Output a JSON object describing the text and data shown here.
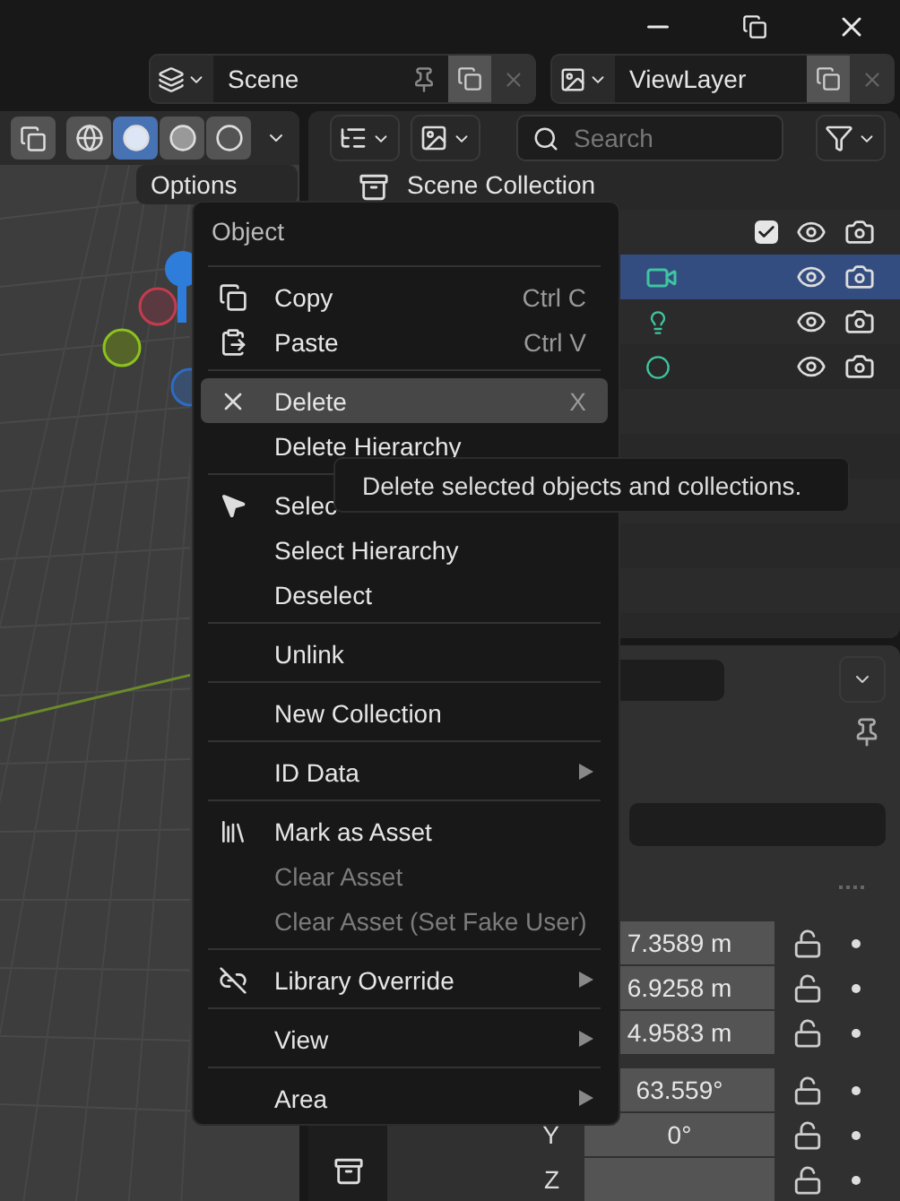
{
  "scene_selector": {
    "name": "Scene"
  },
  "view_layer_selector": {
    "name": "ViewLayer"
  },
  "viewport": {
    "shading_modes": [
      {
        "kind": "wireframe",
        "selected": false
      },
      {
        "kind": "solid",
        "selected": true
      },
      {
        "kind": "material",
        "selected": false
      },
      {
        "kind": "rendered",
        "selected": false
      }
    ],
    "options_label": "Options"
  },
  "outliner": {
    "search": {
      "placeholder": "Search"
    },
    "root": "Scene Collection",
    "rows": [
      {
        "kind": "collection",
        "selected": false,
        "checked": true
      },
      {
        "kind": "camera",
        "selected": true
      },
      {
        "kind": "light",
        "selected": false
      },
      {
        "kind": "mesh",
        "selected": false
      }
    ]
  },
  "properties": {
    "location": [
      "7.3589 m",
      "6.9258 m",
      "4.9583 m"
    ],
    "rotation": [
      {
        "value": "63.559°"
      },
      {
        "axis": "Y",
        "value": "0°"
      },
      {
        "axis": "Z"
      }
    ]
  },
  "context_menu": {
    "title": "Object",
    "sections": [
      [
        {
          "label": "Copy",
          "shortcut": "Ctrl C",
          "kind": "copy",
          "selected": false,
          "disabled": false,
          "submenu": false
        },
        {
          "label": "Paste",
          "shortcut": "Ctrl V",
          "kind": "paste",
          "selected": false,
          "disabled": false,
          "submenu": false
        }
      ],
      [
        {
          "label": "Delete",
          "shortcut": "X",
          "kind": "delete",
          "selected": true,
          "disabled": false,
          "submenu": false
        },
        {
          "label": "Delete Hierarchy",
          "kind": "plain",
          "selected": false,
          "disabled": false,
          "submenu": false
        }
      ],
      [
        {
          "label": "Selec",
          "kind": "select",
          "selected": false,
          "disabled": false,
          "submenu": false
        },
        {
          "label": "Select Hierarchy",
          "kind": "plain",
          "selected": false,
          "disabled": false,
          "submenu": false
        },
        {
          "label": "Deselect",
          "kind": "plain",
          "selected": false,
          "disabled": false,
          "submenu": false
        }
      ],
      [
        {
          "label": "Unlink",
          "kind": "plain",
          "selected": false,
          "disabled": false,
          "submenu": false
        }
      ],
      [
        {
          "label": "New Collection",
          "kind": "plain",
          "selected": false,
          "disabled": false,
          "submenu": false
        }
      ],
      [
        {
          "label": "ID Data",
          "kind": "plain",
          "selected": false,
          "disabled": false,
          "submenu": true
        }
      ],
      [
        {
          "label": "Mark as Asset",
          "kind": "asset",
          "selected": false,
          "disabled": false,
          "submenu": false
        },
        {
          "label": "Clear Asset",
          "kind": "plain",
          "selected": false,
          "disabled": true,
          "submenu": false
        },
        {
          "label": "Clear Asset (Set Fake User)",
          "kind": "plain",
          "selected": false,
          "disabled": true,
          "submenu": false
        }
      ],
      [
        {
          "label": "Library Override",
          "kind": "override",
          "selected": false,
          "disabled": false,
          "submenu": true
        }
      ],
      [
        {
          "label": "View",
          "kind": "plain",
          "selected": false,
          "disabled": false,
          "submenu": true
        }
      ],
      [
        {
          "label": "Area",
          "kind": "plain",
          "selected": false,
          "disabled": false,
          "submenu": true
        }
      ]
    ]
  },
  "tooltip": {
    "text": "Delete selected objects and collections."
  }
}
